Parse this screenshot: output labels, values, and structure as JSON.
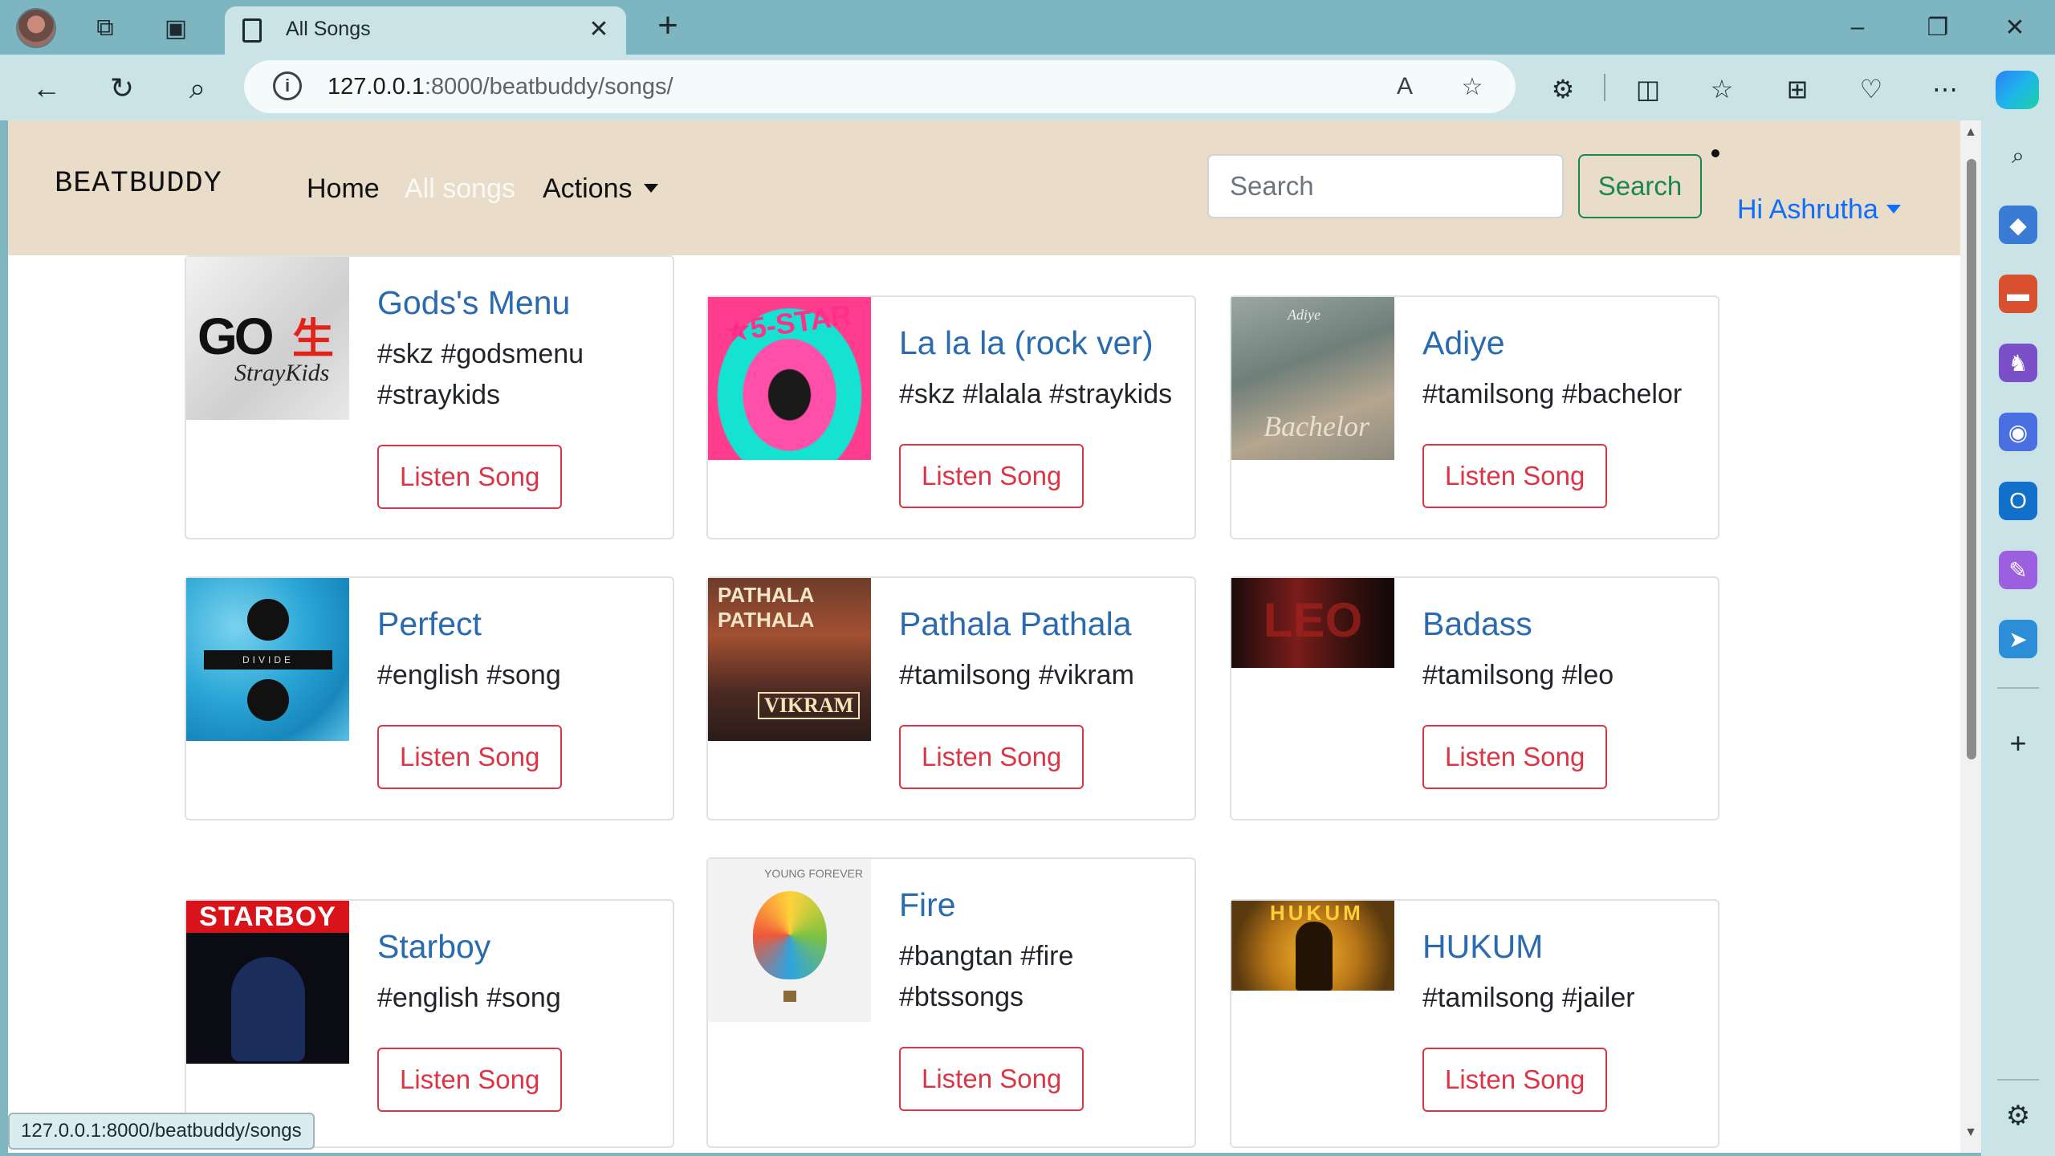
{
  "browser": {
    "tab_title": "All Songs",
    "url_host": "127.0.0.1",
    "url_path": ":8000/beatbuddy/songs/",
    "status_url": "127.0.0.1:8000/beatbuddy/songs"
  },
  "navbar": {
    "brand": "BEATBUDDY",
    "links": {
      "home": "Home",
      "all_songs": "All songs",
      "actions": "Actions"
    },
    "search_placeholder": "Search",
    "search_button": "Search",
    "user_greeting": "Hi Ashrutha"
  },
  "songs": [
    {
      "title": "Gods's Menu",
      "tags": "#skz #godsmenu #straykids",
      "button": "Listen Song",
      "art": "straykids-go-album"
    },
    {
      "title": "La la la (rock ver)",
      "tags": "#skz #lalala #straykids",
      "button": "Listen Song",
      "art": "straykids-star-album"
    },
    {
      "title": "Adiye",
      "tags": "#tamilsong #bachelor",
      "button": "Listen Song",
      "art": "bachelor-poster"
    },
    {
      "title": "Perfect",
      "tags": "#english #song",
      "button": "Listen Song",
      "art": "divide-album"
    },
    {
      "title": "Pathala Pathala",
      "tags": "#tamilsong #vikram",
      "button": "Listen Song",
      "art": "vikram-poster"
    },
    {
      "title": "Badass",
      "tags": "#tamilsong #leo",
      "button": "Listen Song",
      "art": "leo-poster"
    },
    {
      "title": "Starboy",
      "tags": "#english #song",
      "button": "Listen Song",
      "art": "starboy-album"
    },
    {
      "title": "Fire",
      "tags": "#bangtan #fire #btssongs",
      "button": "Listen Song",
      "art": "bts-balloon-album"
    },
    {
      "title": "HUKUM",
      "tags": "#tamilsong #jailer",
      "button": "Listen Song",
      "art": "jailer-poster"
    }
  ],
  "art_text": {
    "godsmenu_a": "GO",
    "godsmenu_b": "生",
    "godsmenu_c": "StrayKids",
    "lalala": "★5-STAR",
    "adiye_a": "Adiye",
    "adiye_b": "Bachelor",
    "perfect": "DIVIDE",
    "pathala_a": "PATHALA PATHALA",
    "pathala_b": "VIKRAM",
    "badass": "LEO",
    "starboy": "STARBOY",
    "fire": "YOUNG FOREVER",
    "hukum": "HUKUM"
  },
  "icons": {
    "back": "back-arrow-icon",
    "refresh": "refresh-icon",
    "search": "search-icon",
    "info": "info-icon",
    "read_aloud": "read-aloud-icon",
    "favorite": "star-icon",
    "extensions": "puzzle-icon",
    "split": "split-screen-icon",
    "favorites": "favorites-list-icon",
    "collections": "collections-icon",
    "health": "browser-essentials-icon",
    "more": "more-icon",
    "settings": "gear-icon"
  },
  "colors": {
    "navbar_bg": "#e9dcc9",
    "title_link": "#2a6bb0",
    "listen_button": "#dc3545",
    "search_button": "#198754",
    "user_link": "#0d6efd"
  }
}
